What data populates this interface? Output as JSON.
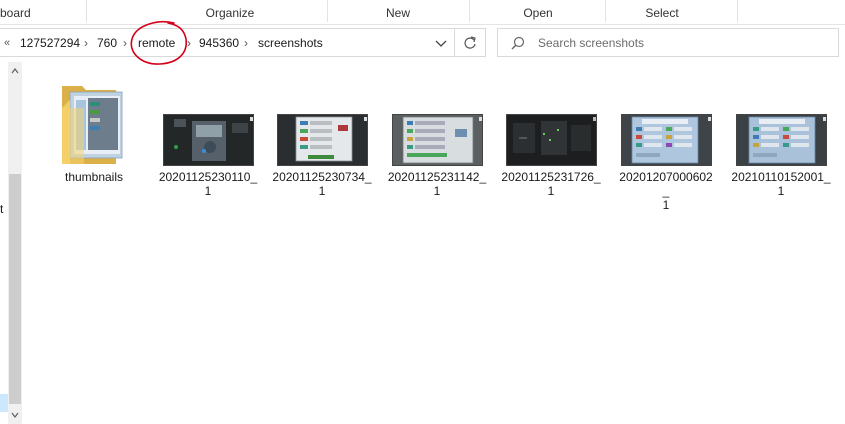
{
  "ribbon": {
    "groups": [
      "board",
      "Organize",
      "New",
      "Open",
      "Select"
    ]
  },
  "address_bar": {
    "overflow": "«",
    "crumbs": [
      "127527294",
      "760",
      "remote",
      "945360",
      "screenshots"
    ],
    "separator": "›"
  },
  "search": {
    "placeholder": "Search screenshots"
  },
  "nav": {
    "partial_text": "t"
  },
  "files": [
    {
      "name": "thumbnails",
      "type": "folder"
    },
    {
      "name": "20201125230110_1",
      "line1": "20201125230110_",
      "line2": "1",
      "type": "image",
      "style": "dark-scene"
    },
    {
      "name": "20201125230734_1",
      "line1": "20201125230734_",
      "line2": "1",
      "type": "image",
      "style": "dialog"
    },
    {
      "name": "20201125231142_1",
      "line1": "20201125231142_",
      "line2": "1",
      "type": "image",
      "style": "light-dialog"
    },
    {
      "name": "20201125231726_1",
      "line1": "20201125231726_",
      "line2": "1",
      "type": "image",
      "style": "dark"
    },
    {
      "name": "20201207000602_1",
      "line1": "20201207000602_",
      "line2": "1",
      "type": "image",
      "style": "blue-panel"
    },
    {
      "name": "20210110152001_1",
      "line1": "20210110152001_",
      "line2": "1",
      "type": "image",
      "style": "blue-panel"
    }
  ],
  "annotation": {
    "color": "#d4001a",
    "target": "remote"
  },
  "colors": {
    "selection": "#cce8ff",
    "folder": "#f4c542"
  }
}
